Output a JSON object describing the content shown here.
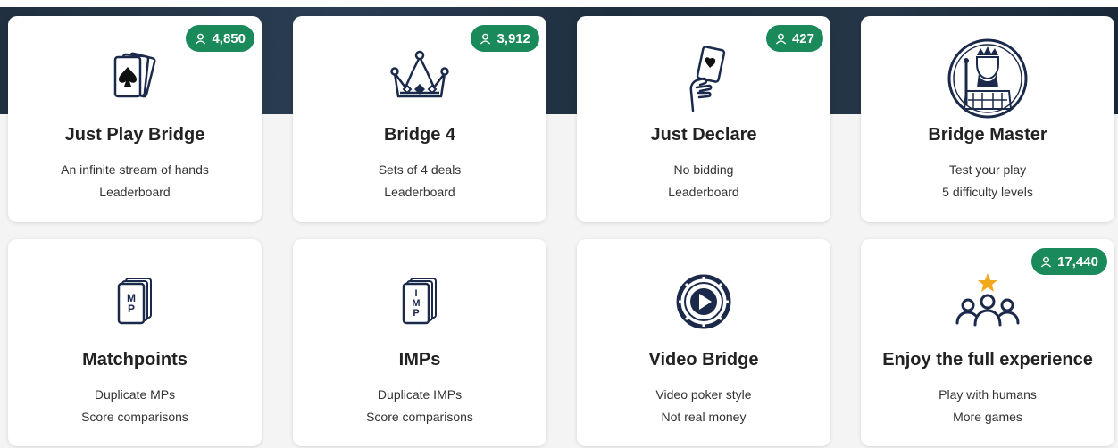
{
  "cards": [
    {
      "title": "Just Play Bridge",
      "line1": "An infinite stream of hands",
      "line2": "Leaderboard",
      "players": "4,850",
      "icon": "cards-spade-icon"
    },
    {
      "title": "Bridge 4",
      "line1": "Sets of 4 deals",
      "line2": "Leaderboard",
      "players": "3,912",
      "icon": "crown-icon"
    },
    {
      "title": "Just Declare",
      "line1": "No bidding",
      "line2": "Leaderboard",
      "players": "427",
      "icon": "hand-card-icon"
    },
    {
      "title": "Bridge Master",
      "line1": "Test your play",
      "line2": "5 difficulty levels",
      "icon": "king-portrait-icon"
    },
    {
      "title": "Matchpoints",
      "line1": "Duplicate MPs",
      "line2": "Score comparisons",
      "icon": "mp-cards-icon",
      "icon_text": [
        "M",
        "P"
      ]
    },
    {
      "title": "IMPs",
      "line1": "Duplicate IMPs",
      "line2": "Score comparisons",
      "icon": "imp-cards-icon",
      "icon_text": [
        "I",
        "M",
        "P"
      ]
    },
    {
      "title": "Video Bridge",
      "line1": "Video poker style",
      "line2": "Not real money",
      "icon": "video-chip-icon"
    },
    {
      "title": "Enjoy the full experience",
      "line1": "Play with humans",
      "line2": "More games",
      "players": "17,440",
      "icon": "people-star-icon"
    }
  ],
  "colors": {
    "badge": "#1a8a5a",
    "icon": "#1b2a4a",
    "star": "#f0a81c"
  }
}
